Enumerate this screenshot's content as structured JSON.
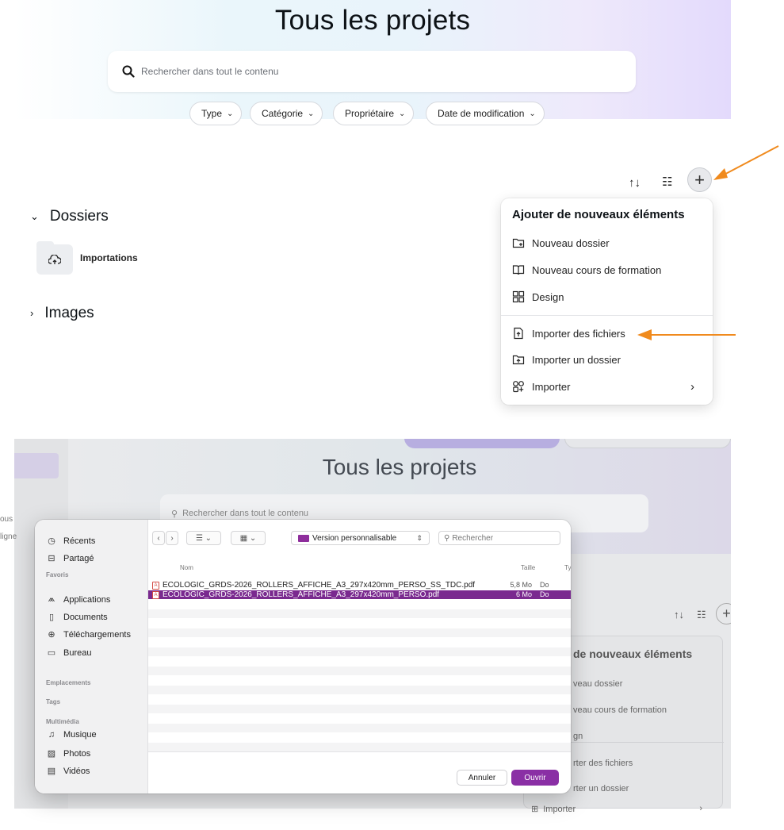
{
  "top": {
    "title": "Tous les projets",
    "search_placeholder": "Rechercher dans tout le contenu",
    "filters": [
      "Type",
      "Catégorie",
      "Propriétaire",
      "Date de modification"
    ],
    "sections": {
      "dossiers": "Dossiers",
      "folder_name": "Importations",
      "images": "Images"
    },
    "menu": {
      "title": "Ajouter de nouveaux éléments",
      "items": [
        "Nouveau dossier",
        "Nouveau cours de formation",
        "Design",
        "Importer des fichiers",
        "Importer un dossier",
        "Importer"
      ]
    },
    "icons": {
      "sort": "sort-icon",
      "list": "list-view-icon",
      "add": "plus-icon"
    },
    "arrow_color": "#f08a1d"
  },
  "bottom": {
    "title": "Tous les projets",
    "search_placeholder": "Rechercher dans tout le contenu",
    "sidebar_fragments": [
      "ous",
      "ligne"
    ],
    "menu": {
      "title": "de nouveaux éléments",
      "items": [
        "veau dossier",
        "veau cours de formation",
        "gn",
        "rter des fichiers",
        "rter un dossier",
        "Importer"
      ]
    },
    "dialog": {
      "sidebar": {
        "top": [
          "Récents",
          "Partagé"
        ],
        "favoris_header": "Favoris",
        "favoris": [
          "Applications",
          "Documents",
          "Téléchargements",
          "Bureau"
        ],
        "emplacements_header": "Emplacements",
        "tags_header": "Tags",
        "multimedia_header": "Multimédia",
        "multimedia": [
          "Musique",
          "Photos",
          "Vidéos"
        ]
      },
      "location": "Version personnalisable",
      "search_placeholder": "Rechercher",
      "columns": {
        "name": "Nom",
        "size": "Taille",
        "type": "Ty"
      },
      "files": [
        {
          "name": "ECOLOGIC_GRDS-2026_ROLLERS_AFFICHE_A3_297x420mm_PERSO_SS_TDC.pdf",
          "size": "5,8 Mo",
          "type": "Do"
        },
        {
          "name": "ECOLOGIC_GRDS-2026_ROLLERS_AFFICHE_A3_297x420mm_PERSO.pdf",
          "size": "6 Mo",
          "type": "Do"
        }
      ],
      "cancel": "Annuler",
      "open": "Ouvrir"
    }
  }
}
